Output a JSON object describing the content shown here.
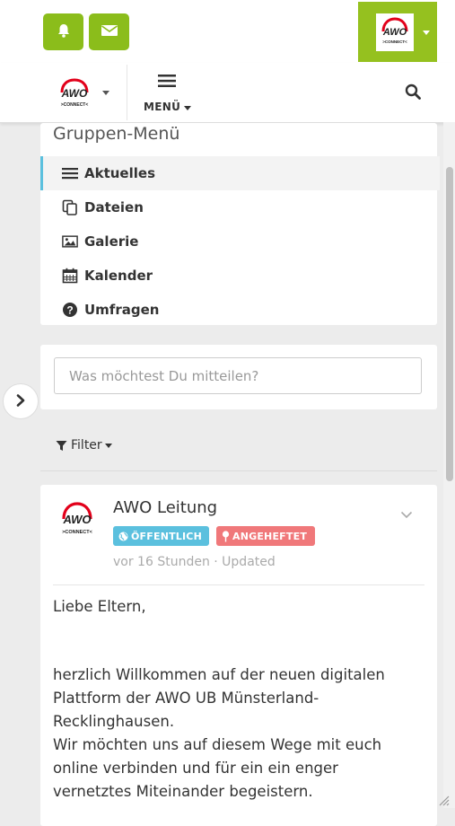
{
  "header": {
    "notifications_icon": "bell-icon",
    "messages_icon": "envelope-icon",
    "account_logo_text": "AWO",
    "account_logo_sub": ">CONNECT<",
    "brand_color": "#95c11f"
  },
  "navbar": {
    "logo_text": "AWO",
    "logo_sub": ">CONNECT<",
    "menu_label": "MENÜ",
    "search_icon": "search-icon"
  },
  "group_menu": {
    "title": "Gruppen-Menü",
    "items": [
      {
        "label": "Aktuelles",
        "icon": "list-icon",
        "active": true
      },
      {
        "label": "Dateien",
        "icon": "files-icon",
        "active": false
      },
      {
        "label": "Galerie",
        "icon": "image-icon",
        "active": false
      },
      {
        "label": "Kalender",
        "icon": "calendar-icon",
        "active": false
      },
      {
        "label": "Umfragen",
        "icon": "question-circle-icon",
        "active": false
      }
    ]
  },
  "composer": {
    "placeholder": "Was möchtest Du mitteilen?"
  },
  "filter": {
    "label": "Filter"
  },
  "post": {
    "author": "AWO Leitung",
    "avatar_text": "AWO",
    "avatar_sub": ">CONNECT<",
    "badge_public": "ÖFFENTLICH",
    "badge_pinned": "ANGEHEFTET",
    "badge_public_color": "#5bc0de",
    "badge_pinned_color": "#f0787a",
    "meta": "vor 16 Stunden · Updated",
    "greeting": "Liebe Eltern,",
    "lines": [
      "herzlich Willkommen auf der neuen digitalen",
      "Plattform der AWO UB Münsterland-",
      "Recklinghausen.",
      "Wir möchten uns auf diesem Wege mit euch",
      "online verbinden und für ein ein enger",
      "vernetztes Miteinander begeistern."
    ]
  }
}
